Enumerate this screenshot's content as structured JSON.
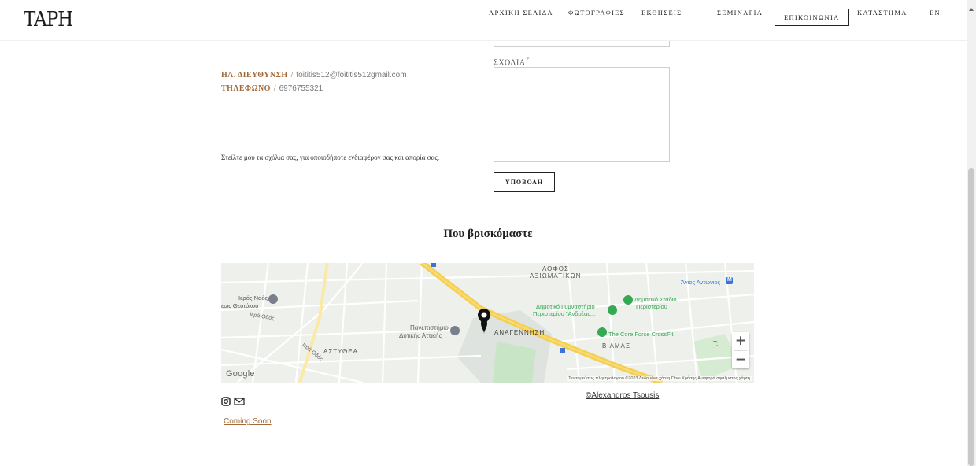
{
  "header": {
    "logo": "TAPH",
    "nav": [
      {
        "label": "ΑΡΧΙΚΗ ΣΕΛΙΔΑ"
      },
      {
        "label": "ΦΩΤΟΓΡΑΦΙΕΣ"
      },
      {
        "label": "ΕΚΘΗΣΕΙΣ"
      },
      {
        "label": "ΣΕΜΙΝΑΡΙΑ"
      },
      {
        "label": "ΕΠΙΚΟΙΝΩΝΙΑ"
      },
      {
        "label": "ΚΑΤΑΣΤΗΜΑ"
      },
      {
        "label": "EN"
      }
    ],
    "active_nav": "ΕΠΙΚΟΙΝΩΝΙΑ"
  },
  "contact": {
    "email_label": "ΗΛ. ΔΙΕΥΘΥΝΣΗ",
    "email_value": "foititis512@foititis512gmail.com",
    "phone_label": "ΤΗΛΕΦΩΝΟ",
    "phone_value": "6976755321",
    "separator": "/",
    "send_text": "Στείλτε μου τα σχόλια σας, για οποιοδήποτε ενδιαφέρον σας και απορία σας."
  },
  "form": {
    "comments_label": "ΣΧΟΛΙΑ",
    "required_mark": "*",
    "comments_value": "",
    "submit_label": "ΥΠΟΒΟΛΗ"
  },
  "location": {
    "title": "Που βρισκόμαστε"
  },
  "map": {
    "labels": {
      "iera_odos": "Ιερά Οδός",
      "iera_odos_2": "Ιερά Οδός",
      "naos": "Ιερός Ναός",
      "theotokou": "εως Θεοτόκου",
      "lofos": "ΛΟΦΟΣ",
      "axiomatikon": "ΑΞΙΩΜΑΤΙΚΩΝ",
      "gym": "Δημοτικό Γυμναστήριο",
      "gym2": "Περιστερίου \"Ανδρέας...",
      "stadio": "Δημοτικό Στάδιο",
      "stadio2": "Περιστερίου",
      "agios": "Άγιος Αντώνιος",
      "metro": "M",
      "panepistimio": "Πανεπιστήμιο",
      "dytikis": "Δυτικής Αττικής",
      "anagennisi": "ΑΝΑΓΕΝΝΗΣΗ",
      "crossfit": "The Core Force CrossFit",
      "viamax": "ΒΙΑΜΑΞ",
      "astytheta": "ΑΣΤΥΘΕΑ",
      "edge_t": "T:",
      "edge_b": "B",
      "google": "Google",
      "attribution": "Συντομεύσεις πληκτρολογίου   ©2023 Δεδομένα χάρτη   Όροι Χρήσης   Αναφορά σφάλματος χάρτη"
    },
    "zoom_in": "+",
    "zoom_out": "−",
    "colors": {
      "highway": "#f4cf52",
      "park": "#c8e6c5",
      "poi_green": "#34a853",
      "metro_blue": "#3c73d8",
      "pin": "#111111"
    }
  },
  "footer": {
    "instagram_icon": "instagram-icon",
    "mail_icon": "mail-icon",
    "credit": "©Alexandros Tsousis",
    "coming_soon": "Coming Soon"
  }
}
